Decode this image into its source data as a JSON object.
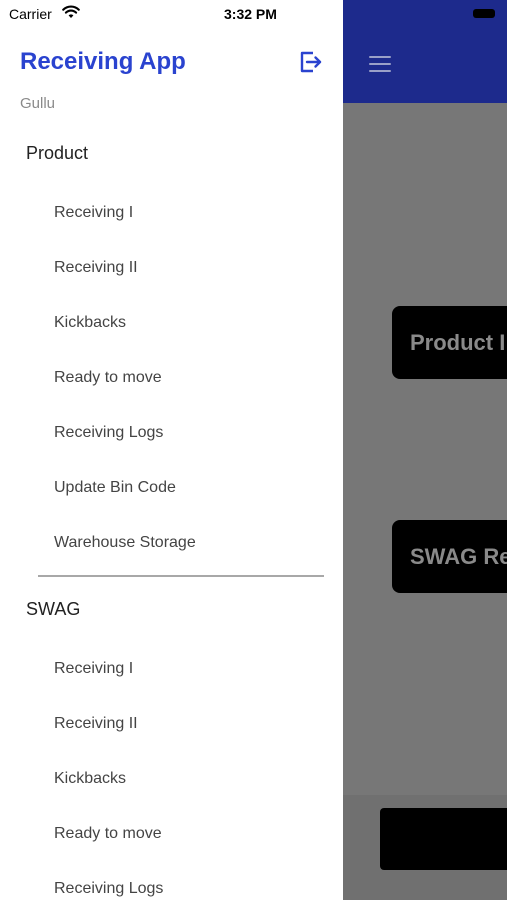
{
  "status_bar": {
    "carrier": "Carrier",
    "time": "3:32 PM"
  },
  "drawer": {
    "title": "Receiving App",
    "user": "Gullu",
    "sections": [
      {
        "title": "Product",
        "items": [
          "Receiving I",
          "Receiving II",
          "Kickbacks",
          "Ready to move",
          "Receiving Logs",
          "Update Bin Code",
          "Warehouse Storage"
        ]
      },
      {
        "title": "SWAG",
        "items": [
          "Receiving I",
          "Receiving II",
          "Kickbacks",
          "Ready to move",
          "Receiving Logs"
        ]
      }
    ]
  },
  "background": {
    "buttons": [
      "Product I",
      "SWAG Re"
    ]
  },
  "colors": {
    "accent": "#2a43cf",
    "header_bg": "#1d2a8c",
    "overlay": "#777777"
  },
  "icons": {
    "logout": "logout-icon",
    "menu": "hamburger-icon",
    "wifi": "wifi-icon"
  }
}
